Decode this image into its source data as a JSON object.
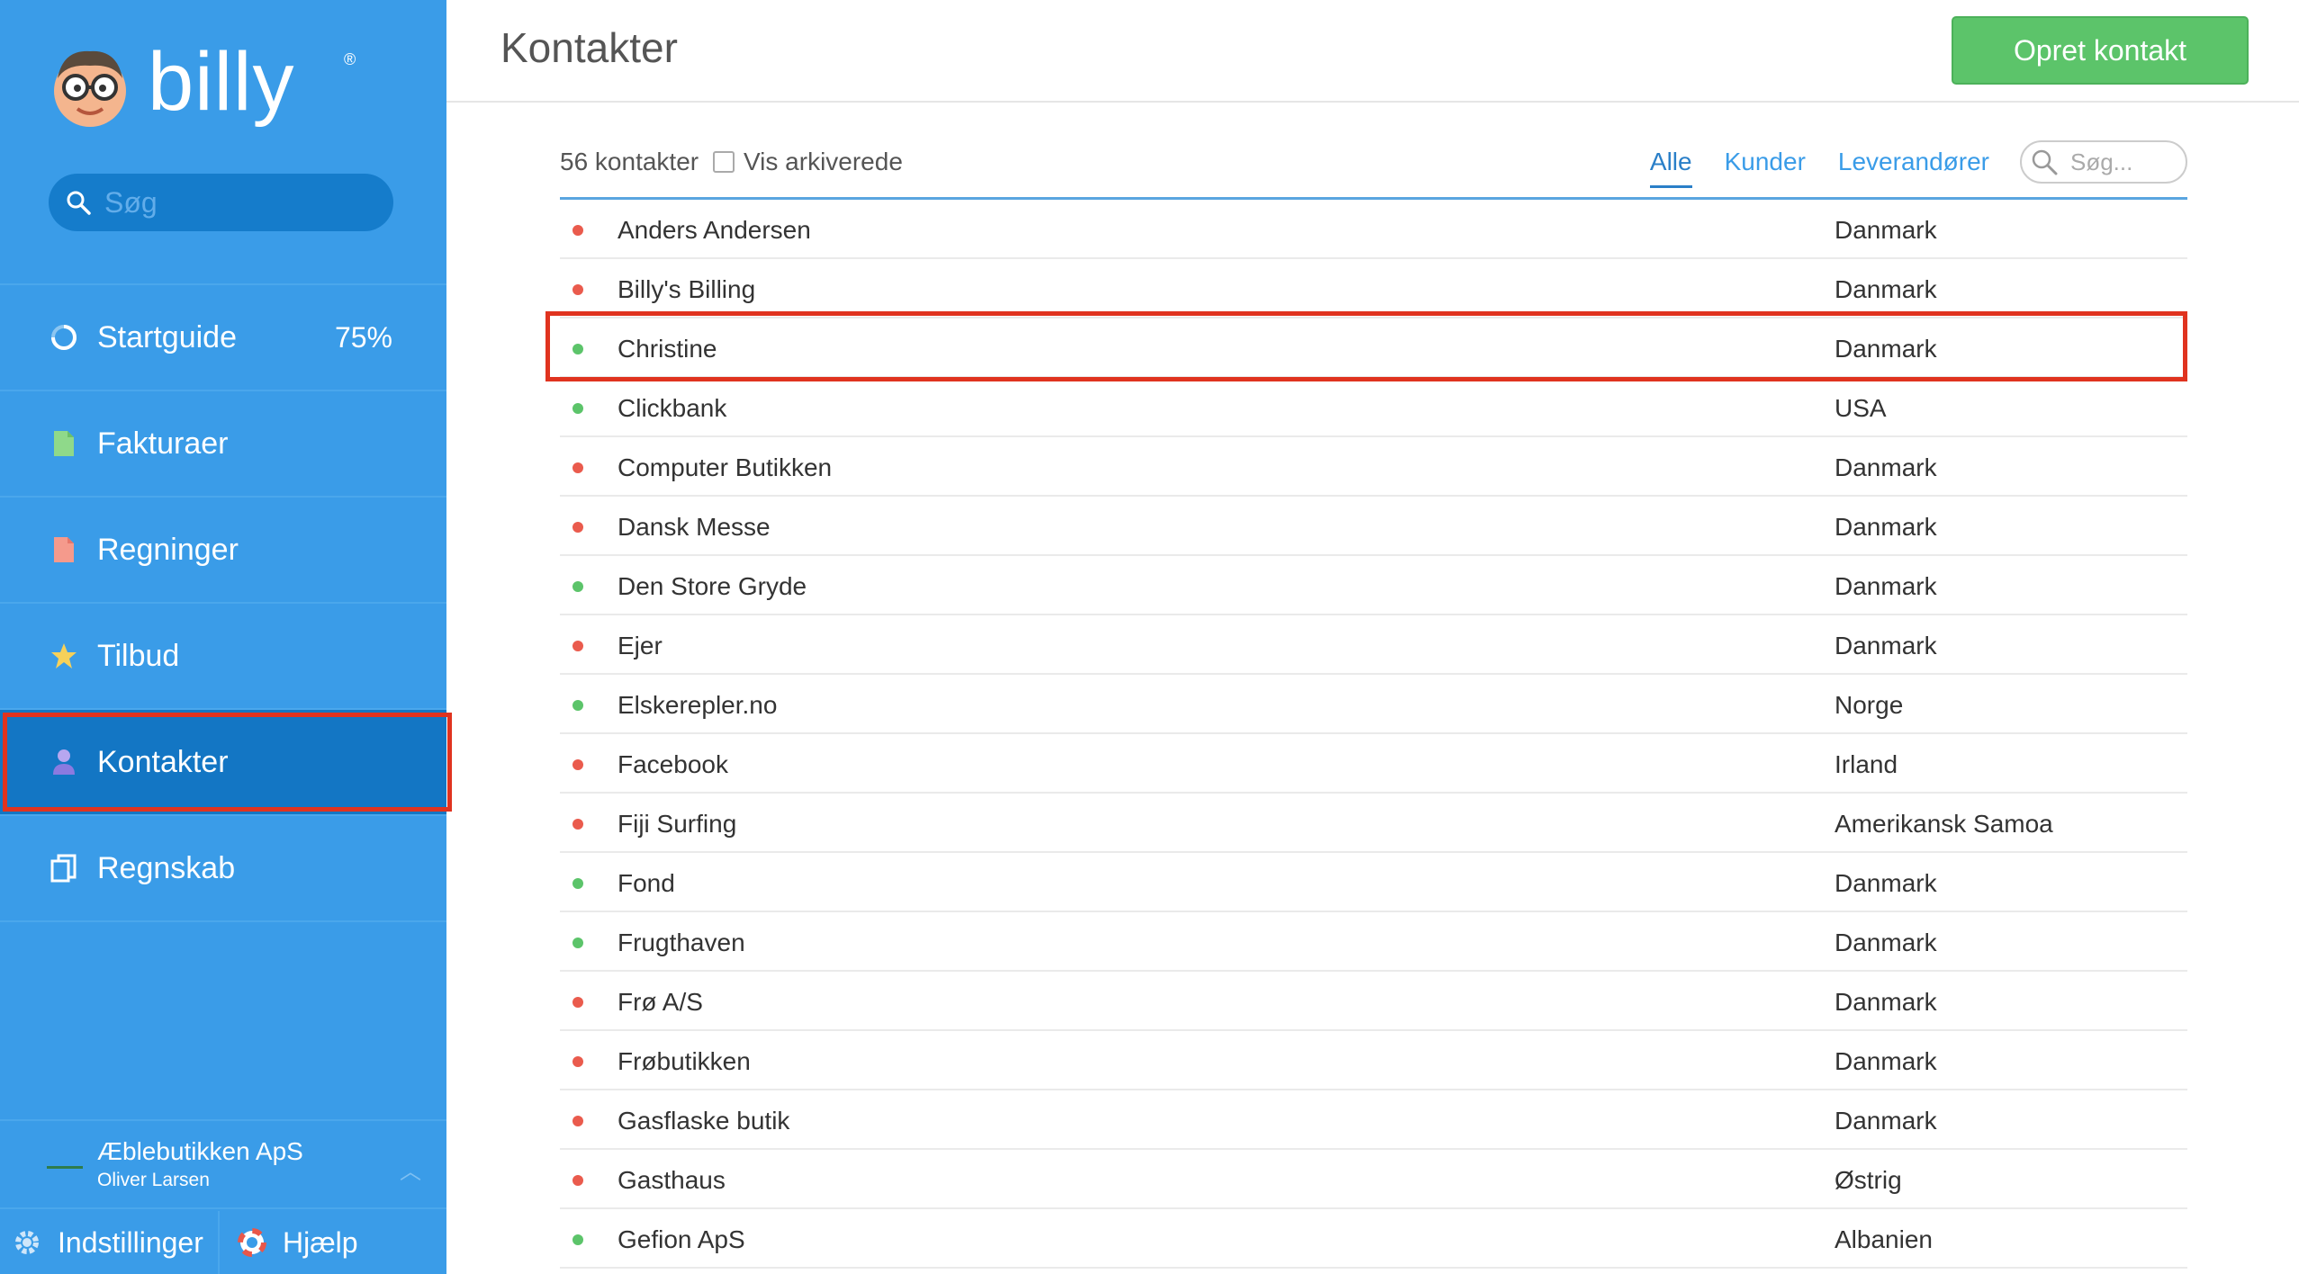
{
  "brand": {
    "logo_text": "billy",
    "registered_mark": "®"
  },
  "sidebar": {
    "search_placeholder": "Søg",
    "items": [
      {
        "label": "Startguide",
        "icon": "progress-ring-icon",
        "progress": "75%"
      },
      {
        "label": "Fakturaer",
        "icon": "invoice-document-icon"
      },
      {
        "label": "Regninger",
        "icon": "bill-document-icon"
      },
      {
        "label": "Tilbud",
        "icon": "star-icon"
      },
      {
        "label": "Kontakter",
        "icon": "person-icon",
        "active": true
      },
      {
        "label": "Regnskab",
        "icon": "ledger-icon"
      }
    ],
    "company": {
      "name": "Æblebutikken ApS",
      "user": "Oliver Larsen"
    },
    "footer": {
      "settings_label": "Indstillinger",
      "help_label": "Hjælp"
    }
  },
  "header": {
    "title": "Kontakter",
    "create_button": "Opret kontakt"
  },
  "toolbar": {
    "count": "56 kontakter",
    "show_archived": "Vis arkiverede",
    "filters": [
      "Alle",
      "Kunder",
      "Leverandører"
    ],
    "active_filter": "Alle",
    "search_placeholder": "Søg..."
  },
  "colors": {
    "sidebar_bg": "#3a9ce8",
    "sidebar_active_bg": "#1376c4",
    "primary_button": "#5cc46a",
    "status_red": "#ea5b4d",
    "status_green": "#5cc46a",
    "highlight_frame": "#e0331f"
  },
  "contacts": [
    {
      "name": "Anders Andersen",
      "country": "Danmark",
      "status": "red"
    },
    {
      "name": "Billy's Billing",
      "country": "Danmark",
      "status": "red"
    },
    {
      "name": "Christine",
      "country": "Danmark",
      "status": "green",
      "highlighted": true
    },
    {
      "name": "Clickbank",
      "country": "USA",
      "status": "green"
    },
    {
      "name": "Computer Butikken",
      "country": "Danmark",
      "status": "red"
    },
    {
      "name": "Dansk Messe",
      "country": "Danmark",
      "status": "red"
    },
    {
      "name": "Den Store Gryde",
      "country": "Danmark",
      "status": "green"
    },
    {
      "name": "Ejer",
      "country": "Danmark",
      "status": "red"
    },
    {
      "name": "Elskerepler.no",
      "country": "Norge",
      "status": "green"
    },
    {
      "name": "Facebook",
      "country": "Irland",
      "status": "red"
    },
    {
      "name": "Fiji Surfing",
      "country": "Amerikansk Samoa",
      "status": "red"
    },
    {
      "name": "Fond",
      "country": "Danmark",
      "status": "green"
    },
    {
      "name": "Frugthaven",
      "country": "Danmark",
      "status": "green"
    },
    {
      "name": "Frø A/S",
      "country": "Danmark",
      "status": "red"
    },
    {
      "name": "Frøbutikken",
      "country": "Danmark",
      "status": "red"
    },
    {
      "name": "Gasflaske butik",
      "country": "Danmark",
      "status": "red"
    },
    {
      "name": "Gasthaus",
      "country": "Østrig",
      "status": "red"
    },
    {
      "name": "Gefion ApS",
      "country": "Albanien",
      "status": "green"
    }
  ]
}
